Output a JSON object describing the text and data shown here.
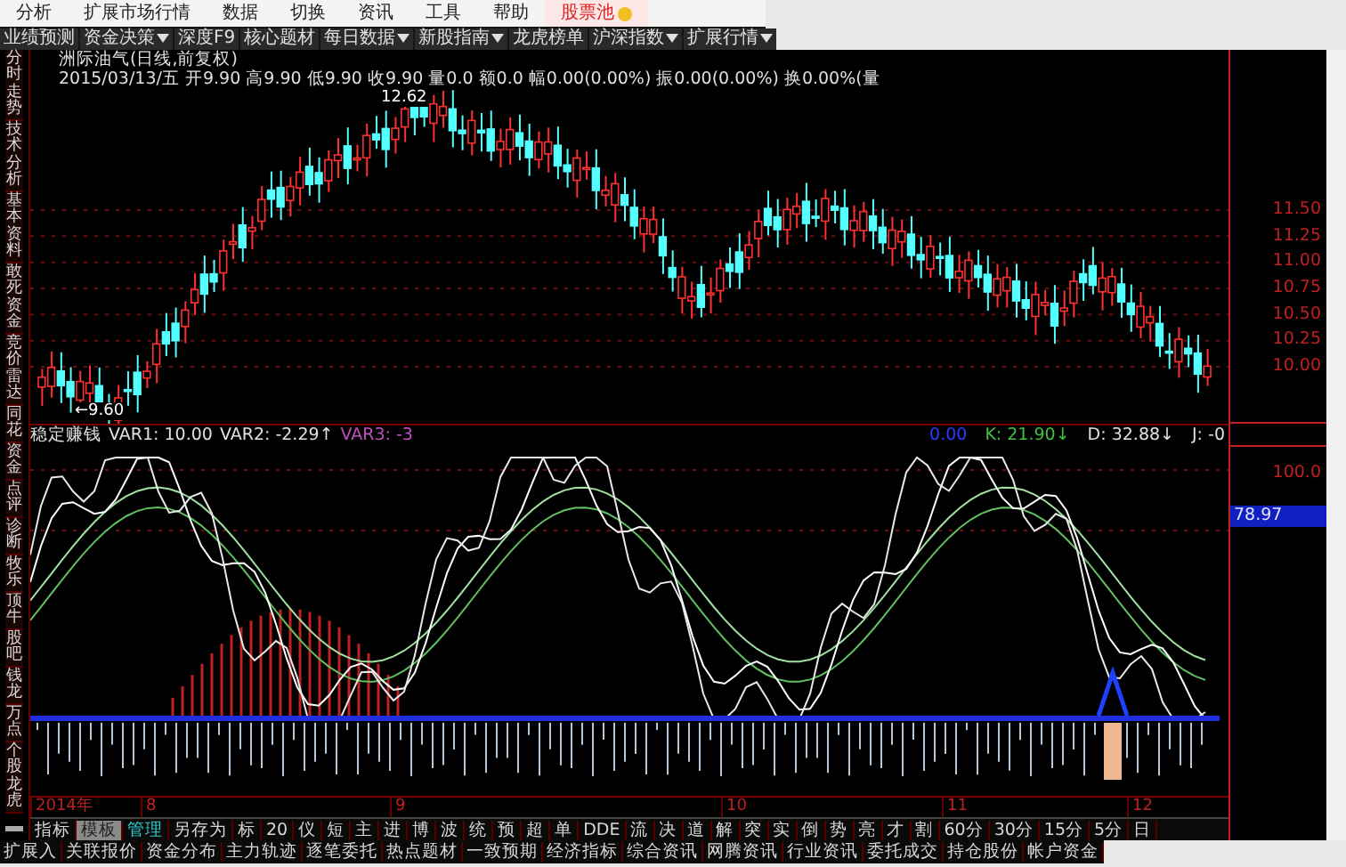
{
  "menu": [
    {
      "label": "分析",
      "selected": false
    },
    {
      "label": "扩展市场行情",
      "selected": false
    },
    {
      "label": "数据",
      "selected": false
    },
    {
      "label": "切换",
      "selected": false
    },
    {
      "label": "资讯",
      "selected": false
    },
    {
      "label": "工具",
      "selected": false
    },
    {
      "label": "帮助",
      "selected": false
    },
    {
      "label": "股票池",
      "selected": true
    }
  ],
  "toolbar": [
    {
      "label": "业绩预测",
      "dropdown": false
    },
    {
      "label": "资金决策",
      "dropdown": true
    },
    {
      "label": "深度F9",
      "dropdown": false
    },
    {
      "label": "核心题材",
      "dropdown": false
    },
    {
      "label": "每日数据",
      "dropdown": true
    },
    {
      "label": "新股指南",
      "dropdown": true
    },
    {
      "label": "龙虎榜单",
      "dropdown": false
    },
    {
      "label": "沪深指数",
      "dropdown": true
    },
    {
      "label": "扩展行情",
      "dropdown": true
    }
  ],
  "sidebar": [
    {
      "label": "分时走势"
    },
    {
      "label": "技术分析"
    },
    {
      "label": "基本资料"
    },
    {
      "label": "敢死资金"
    },
    {
      "label": "竞价雷达"
    },
    {
      "label": "同花"
    },
    {
      "label": "资金"
    },
    {
      "label": "点评"
    },
    {
      "label": "诊断"
    },
    {
      "label": "牧乐"
    },
    {
      "label": "顶牛"
    },
    {
      "label": "股吧"
    },
    {
      "label": "钱龙"
    },
    {
      "label": "万点"
    },
    {
      "label": "个股龙虎"
    }
  ],
  "stock_title": "洲际油气(日线,前复权)",
  "quote_line": "2015/03/13/五 开9.90 高9.90 低9.90 收9.90 量0.0 额0.0 幅0.00(0.00%) 振0.00(0.00%) 换0.00%(量",
  "high_label": "12.62",
  "low_label": "←9.60",
  "indicator": {
    "name": "稳定赚钱",
    "values": [
      {
        "text": "VAR1: 10.00",
        "color": "#e0e0e0"
      },
      {
        "text": "VAR2: -2.29↑",
        "color": "#e0e0e0"
      },
      {
        "text": "VAR3: -3",
        "color": "#c050c0"
      }
    ],
    "right_values": [
      {
        "text": "0.00",
        "color": "#2a3cff"
      },
      {
        "text": "K: 21.90↓",
        "color": "#40c040"
      },
      {
        "text": "D: 32.88↓",
        "color": "#e0e0e0"
      },
      {
        "text": "J: -0",
        "color": "#e0e0e0"
      }
    ]
  },
  "price_axis": [
    "11.50",
    "11.25",
    "11.00",
    "10.75",
    "10.50",
    "10.25",
    "10.00"
  ],
  "indicator_axis": [
    "100.0"
  ],
  "current_value": "78.97",
  "date_axis": [
    "2014年",
    "8",
    "9",
    "10",
    "11",
    "12"
  ],
  "bottom_tabs": [
    {
      "label": "指标",
      "selected": false,
      "kind": "normal"
    },
    {
      "label": "模板",
      "selected": true,
      "kind": "normal"
    },
    {
      "label": "管理",
      "selected": false,
      "kind": "accent"
    },
    {
      "label": "另存为",
      "selected": false,
      "kind": "normal"
    },
    {
      "label": "标",
      "selected": false,
      "kind": "normal"
    },
    {
      "label": "20",
      "selected": false,
      "kind": "normal"
    },
    {
      "label": "仪",
      "selected": false,
      "kind": "normal"
    },
    {
      "label": "短",
      "selected": false,
      "kind": "normal"
    },
    {
      "label": "主",
      "selected": false,
      "kind": "normal"
    },
    {
      "label": "进",
      "selected": false,
      "kind": "normal"
    },
    {
      "label": "博",
      "selected": false,
      "kind": "normal"
    },
    {
      "label": "波",
      "selected": false,
      "kind": "normal"
    },
    {
      "label": "统",
      "selected": false,
      "kind": "normal"
    },
    {
      "label": "预",
      "selected": false,
      "kind": "normal"
    },
    {
      "label": "超",
      "selected": false,
      "kind": "normal"
    },
    {
      "label": "单",
      "selected": false,
      "kind": "normal"
    },
    {
      "label": "DDE",
      "selected": false,
      "kind": "normal"
    },
    {
      "label": "流",
      "selected": false,
      "kind": "normal"
    },
    {
      "label": "决",
      "selected": false,
      "kind": "normal"
    },
    {
      "label": "道",
      "selected": false,
      "kind": "normal"
    },
    {
      "label": "解",
      "selected": false,
      "kind": "normal"
    },
    {
      "label": "突",
      "selected": false,
      "kind": "normal"
    },
    {
      "label": "实",
      "selected": false,
      "kind": "normal"
    },
    {
      "label": "倒",
      "selected": false,
      "kind": "normal"
    },
    {
      "label": "势",
      "selected": false,
      "kind": "normal"
    },
    {
      "label": "亮",
      "selected": false,
      "kind": "normal"
    },
    {
      "label": "才",
      "selected": false,
      "kind": "normal"
    },
    {
      "label": "割",
      "selected": false,
      "kind": "normal"
    },
    {
      "label": "60分",
      "selected": false,
      "kind": "normal"
    },
    {
      "label": "30分",
      "selected": false,
      "kind": "normal"
    },
    {
      "label": "15分",
      "selected": false,
      "kind": "normal"
    },
    {
      "label": "5分",
      "selected": false,
      "kind": "normal"
    },
    {
      "label": "日",
      "selected": false,
      "kind": "normal"
    }
  ],
  "extension_tabs": [
    {
      "label": "扩展入"
    },
    {
      "label": "关联报价"
    },
    {
      "label": "资金分布"
    },
    {
      "label": "主力轨迹"
    },
    {
      "label": "逐笔委托"
    },
    {
      "label": "热点题材"
    },
    {
      "label": "一致预期"
    },
    {
      "label": "经济指标"
    },
    {
      "label": "综合资讯"
    },
    {
      "label": "网腾资讯"
    },
    {
      "label": "行业资讯"
    },
    {
      "label": "委托成交"
    },
    {
      "label": "持仓股份"
    },
    {
      "label": "帐户资金"
    }
  ]
}
